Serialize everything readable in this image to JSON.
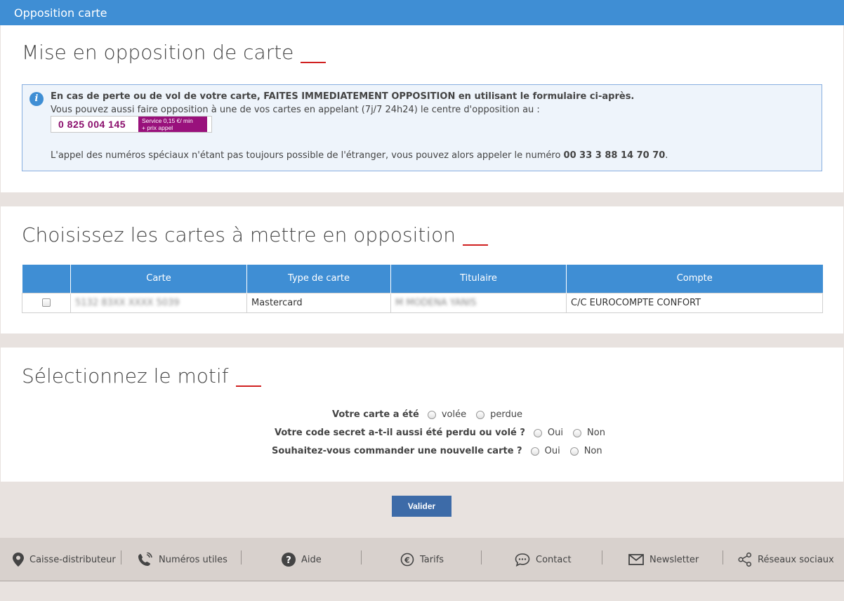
{
  "header": {
    "title": "Opposition carte"
  },
  "section1": {
    "title": "Mise en opposition de carte",
    "info": {
      "line1_bold": "En cas de perte ou de vol de votre carte, FAITES IMMEDIATEMENT OPPOSITION en utilisant le formulaire ci-après.",
      "line2": "Vous pouvez aussi faire opposition à une de vos cartes en appelant (7j/7 24h24) le centre d'opposition au :",
      "phone": "0 825 004 145",
      "phone_tag_line1": "Service  0,15 €/ min",
      "phone_tag_line2": "+ prix  appel",
      "line3_prefix": "L'appel des numéros spéciaux n'étant pas toujours possible de l'étranger, vous pouvez alors appeler le numéro ",
      "line3_number": "00 33 3 88 14 70 70",
      "line3_suffix": "."
    }
  },
  "section2": {
    "title": "Choisissez les cartes à mettre en opposition",
    "table": {
      "headers": [
        "",
        "Carte",
        "Type de carte",
        "Titulaire",
        "Compte"
      ],
      "rows": [
        {
          "carte": "5132 83XX XXXX 5039",
          "type": "Mastercard",
          "titulaire": "M MODENA YANIS",
          "compte": "C/C EUROCOMPTE CONFORT"
        }
      ]
    }
  },
  "section3": {
    "title": "Sélectionnez le motif",
    "q1": {
      "label": "Votre carte a été",
      "options": [
        "volée",
        "perdue"
      ]
    },
    "q2": {
      "label": "Votre code secret a-t-il aussi été perdu ou volé ?",
      "options": [
        "Oui",
        "Non"
      ]
    },
    "q3": {
      "label": "Souhaitez-vous commander une nouvelle carte ?",
      "options": [
        "Oui",
        "Non"
      ]
    }
  },
  "actions": {
    "validate_label": "Valider"
  },
  "footer": {
    "items": [
      {
        "label": "Caisse-distributeur",
        "icon": "location-pin-icon"
      },
      {
        "label": "Numéros utiles",
        "icon": "phone-icon"
      },
      {
        "label": "Aide",
        "icon": "help-icon"
      },
      {
        "label": "Tarifs",
        "icon": "euro-icon"
      },
      {
        "label": "Contact",
        "icon": "chat-icon"
      },
      {
        "label": "Newsletter",
        "icon": "envelope-icon"
      },
      {
        "label": "Réseaux sociaux",
        "icon": "share-icon"
      }
    ]
  },
  "colors": {
    "primary": "#3f8ed4",
    "accent_red": "#d02020",
    "button": "#3d6ba8",
    "phone_magenta": "#99117c"
  }
}
